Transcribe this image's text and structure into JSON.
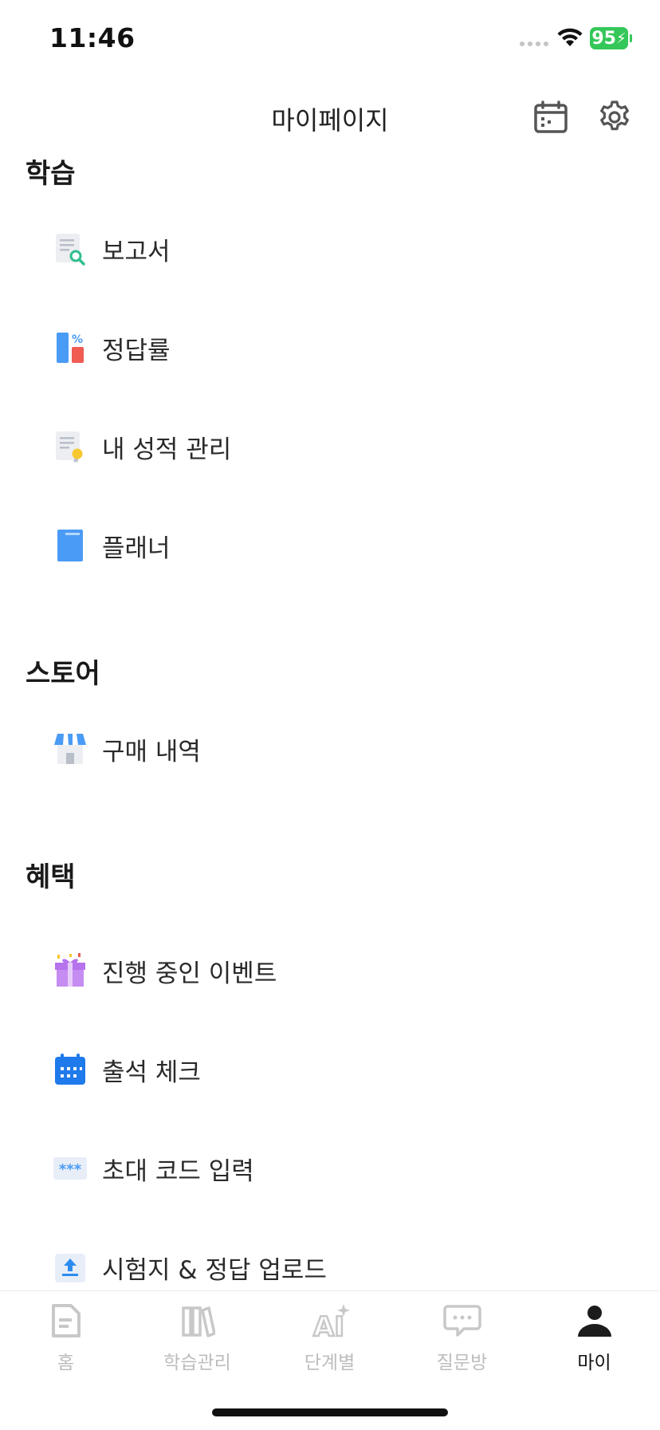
{
  "status_bar": {
    "time": "11:46",
    "battery": "95"
  },
  "header": {
    "title": "마이페이지",
    "calendar_icon": "calendar-icon",
    "settings_icon": "gear-icon"
  },
  "sections": {
    "study": {
      "title": "학습",
      "items": [
        {
          "label": "보고서",
          "icon": "report-search-icon"
        },
        {
          "label": "정답률",
          "icon": "accuracy-chart-icon"
        },
        {
          "label": "내 성적 관리",
          "icon": "grade-certificate-icon"
        },
        {
          "label": "플래너",
          "icon": "planner-book-icon"
        }
      ]
    },
    "store": {
      "title": "스토어",
      "items": [
        {
          "label": "구매 내역",
          "icon": "store-icon"
        }
      ]
    },
    "benefits": {
      "title": "혜택",
      "items": [
        {
          "label": "진행 중인 이벤트",
          "icon": "gift-icon"
        },
        {
          "label": "출석 체크",
          "icon": "attendance-calendar-icon"
        },
        {
          "label": "초대 코드 입력",
          "icon": "password-code-icon"
        },
        {
          "label": "시험지 & 정답 업로드",
          "icon": "upload-icon"
        }
      ]
    }
  },
  "tab_bar": {
    "tabs": [
      {
        "label": "홈",
        "icon": "home-document-icon",
        "active": false
      },
      {
        "label": "학습관리",
        "icon": "books-icon",
        "active": false
      },
      {
        "label": "단계별",
        "icon": "ai-sparkle-icon",
        "active": false
      },
      {
        "label": "질문방",
        "icon": "chat-bubble-icon",
        "active": false
      },
      {
        "label": "마이",
        "icon": "person-icon",
        "active": true
      }
    ]
  },
  "colors": {
    "battery_green": "#34c759",
    "blue": "#4a9bf5",
    "red": "#f05b52",
    "purple": "#c58cf2",
    "active_tab": "#111111",
    "inactive_tab": "#bdbdbd"
  }
}
